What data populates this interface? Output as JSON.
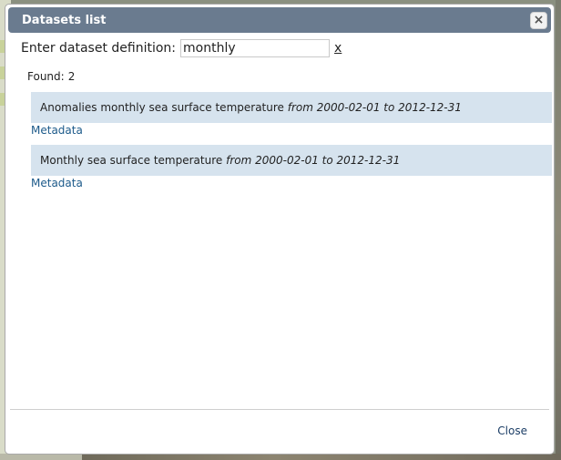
{
  "dialog": {
    "title": "Datasets list",
    "close_icon": "close-icon",
    "filter": {
      "label": "Enter dataset definition:",
      "value": "monthly",
      "clear_label": "x"
    },
    "found": {
      "label": "Found:",
      "count": "2"
    },
    "results": [
      {
        "name": "Anomalies monthly sea surface temperature",
        "range": "from 2000-02-01 to 2012-12-31",
        "metadata_label": "Metadata"
      },
      {
        "name": "Monthly sea surface temperature",
        "range": "from 2000-02-01 to 2012-12-31",
        "metadata_label": "Metadata"
      }
    ],
    "footer": {
      "close_label": "Close"
    }
  }
}
